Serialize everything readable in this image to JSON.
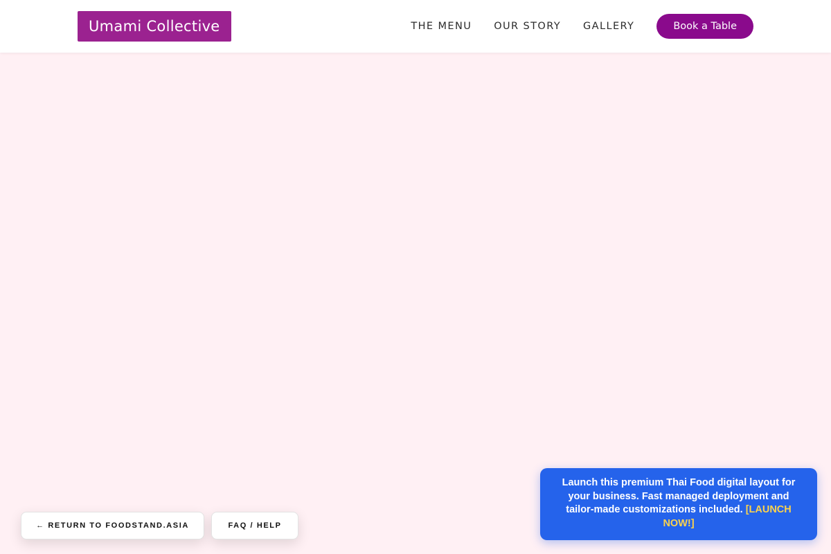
{
  "header": {
    "logo": "Umami Collective",
    "nav": [
      {
        "label": "THE MENU"
      },
      {
        "label": "OUR STORY"
      },
      {
        "label": "GALLERY"
      }
    ],
    "cta": "Book a Table"
  },
  "footer_buttons": {
    "return": "← RETURN TO FOODSTAND.ASIA",
    "faq": "FAQ / HELP"
  },
  "promo": {
    "text": "Launch this premium Thai Food digital layout for your business. Fast managed deployment and tailor-made customizations included.",
    "link": "[LAUNCH NOW!]"
  },
  "colors": {
    "page_background": "#fff0f4",
    "logo_background": "#9b2290",
    "cta_background": "#8a0a8c",
    "promo_background": "#2563eb",
    "promo_link": "#fcd34d"
  }
}
